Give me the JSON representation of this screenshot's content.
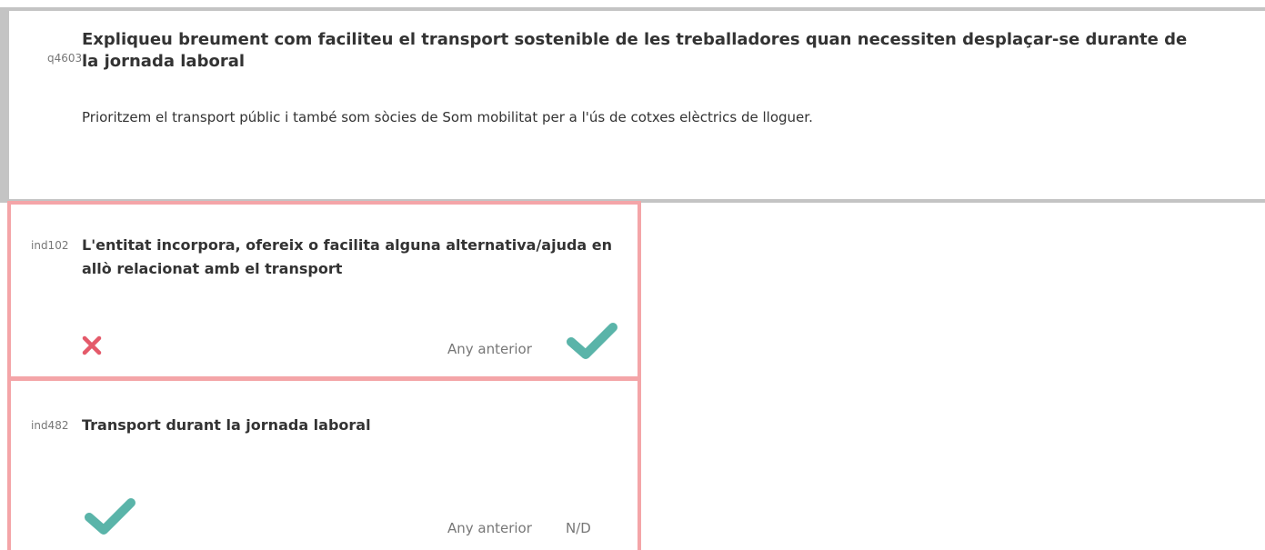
{
  "question": {
    "code": "q4603",
    "title": "Expliqueu breument com faciliteu el transport sostenible de les treballadores quan necessiten desplaçar-se durante de la jornada laboral",
    "answer": "Prioritzem el transport públic i també som sòcies de Som mobilitat per a l'ús de cotxes elèctrics de lloguer."
  },
  "indicators": [
    {
      "code": "ind102",
      "title": "L'entitat incorpora, ofereix o facilita alguna alternativa/ajuda en allò relacionat amb el transport",
      "current_status_icon": "cross-icon",
      "previous_year_label": "Any anterior",
      "previous_status_icon": "check-icon"
    },
    {
      "code": "ind482",
      "title": "Transport durant la jornada laboral",
      "current_status_icon": "check-icon",
      "previous_year_label": "Any anterior",
      "previous_value": "N/D"
    }
  ],
  "colors": {
    "question_border": "#c4c4c4",
    "indicator_border": "#f4a5a8",
    "check": "#5ab4a9",
    "cross": "#e45a6a"
  }
}
